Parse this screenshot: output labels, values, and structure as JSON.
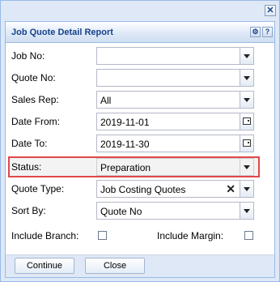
{
  "window": {
    "close_glyph": "✕"
  },
  "panel": {
    "title": "Job Quote Detail Report",
    "tools": {
      "gear_glyph": "⚙",
      "help_glyph": "?"
    }
  },
  "form": {
    "job_no": {
      "label": "Job No:",
      "value": ""
    },
    "quote_no": {
      "label": "Quote No:",
      "value": ""
    },
    "sales_rep": {
      "label": "Sales Rep:",
      "value": "All"
    },
    "date_from": {
      "label": "Date From:",
      "value": "2019-11-01"
    },
    "date_to": {
      "label": "Date To:",
      "value": "2019-11-30"
    },
    "status": {
      "label": "Status:",
      "value": "Preparation"
    },
    "quote_type": {
      "label": "Quote Type:",
      "value": "Job Costing Quotes",
      "clear_glyph": "✕"
    },
    "sort_by": {
      "label": "Sort By:",
      "value": "Quote No"
    },
    "include_branch": {
      "label": "Include Branch:",
      "checked": false
    },
    "include_margin": {
      "label": "Include Margin:",
      "checked": false
    }
  },
  "buttons": {
    "continue": "Continue",
    "close": "Close"
  },
  "colors": {
    "highlight": "#e04848",
    "title": "#15428b",
    "border": "#99bbe8"
  }
}
